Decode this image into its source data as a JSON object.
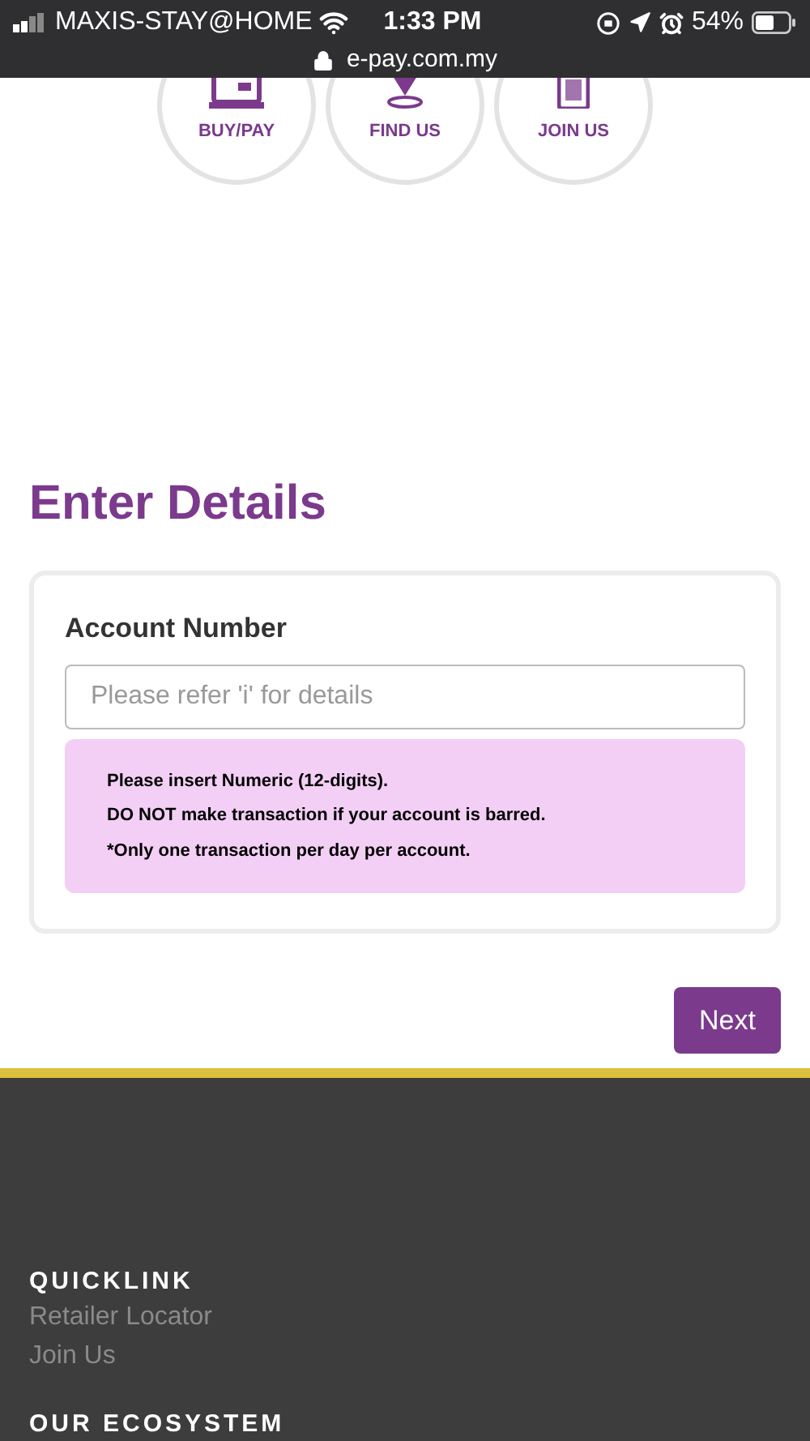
{
  "status_bar": {
    "carrier": "MAXIS-STAY@HOME",
    "time": "1:33 PM",
    "battery": "54%",
    "url": "e-pay.com.my"
  },
  "nav_circles": [
    {
      "label": "BUY/PAY",
      "kind": "register"
    },
    {
      "label": "FIND US",
      "kind": "pin"
    },
    {
      "label": "JOIN US",
      "kind": "terminal"
    }
  ],
  "form": {
    "title": "Enter Details",
    "field_label": "Account Number",
    "placeholder": "Please refer 'i' for details",
    "notes": [
      "Please insert Numeric (12-digits).",
      "DO NOT make transaction if your account is barred.",
      "*Only one transaction per day per account."
    ],
    "next_button": "Next"
  },
  "footer": {
    "sections": [
      {
        "heading": "QUICKLINK",
        "links": [
          "Retailer Locator",
          "Join Us"
        ]
      },
      {
        "heading": "OUR ECOSYSTEM"
      }
    ]
  }
}
